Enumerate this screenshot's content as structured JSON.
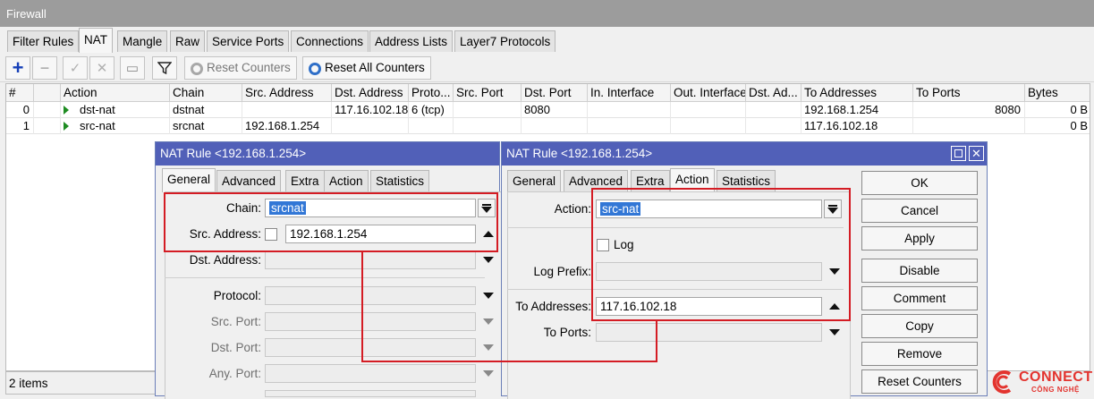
{
  "firewall": {
    "title": "Firewall",
    "tabs": [
      "Filter Rules",
      "NAT",
      "Mangle",
      "Raw",
      "Service Ports",
      "Connections",
      "Address Lists",
      "Layer7 Protocols"
    ],
    "active_tab": "NAT",
    "toolbar": {
      "reset_counters": "Reset Counters",
      "reset_all_counters": "Reset All Counters"
    },
    "columns": [
      "#",
      "Action",
      "Chain",
      "Src. Address",
      "Dst. Address",
      "Proto...",
      "Src. Port",
      "Dst. Port",
      "In. Interface",
      "Out. Interface",
      "Dst. Ad...",
      "To Addresses",
      "To Ports",
      "Bytes"
    ],
    "rows": [
      {
        "num": "0",
        "action": "dst-nat",
        "chain": "dstnat",
        "src_address": "",
        "dst_address": "117.16.102.18",
        "protocol": "6 (tcp)",
        "dst_port": "8080",
        "to_addresses": "192.168.1.254",
        "to_ports": "8080",
        "bytes": "0 B"
      },
      {
        "num": "1",
        "action": "src-nat",
        "chain": "srcnat",
        "src_address": "192.168.1.254",
        "dst_address": "",
        "protocol": "",
        "dst_port": "",
        "to_addresses": "117.16.102.18",
        "to_ports": "",
        "bytes": "0 B"
      }
    ],
    "status": "2 items"
  },
  "dialog_general": {
    "title": "NAT Rule <192.168.1.254>",
    "tabs": [
      "General",
      "Advanced",
      "Extra",
      "Action",
      "Statistics"
    ],
    "active_tab": "General",
    "fields": {
      "chain_label": "Chain:",
      "chain_value": "srcnat",
      "src_address_label": "Src. Address:",
      "src_address_value": "192.168.1.254",
      "dst_address_label": "Dst. Address:",
      "protocol_label": "Protocol:",
      "src_port_label": "Src. Port:",
      "dst_port_label": "Dst. Port:",
      "any_port_label": "Any. Port:"
    }
  },
  "dialog_action": {
    "title": "NAT Rule <192.168.1.254>",
    "tabs": [
      "General",
      "Advanced",
      "Extra",
      "Action",
      "Statistics"
    ],
    "active_tab": "Action",
    "fields": {
      "action_label": "Action:",
      "action_value": "src-nat",
      "log_label": "Log",
      "log_prefix_label": "Log Prefix:",
      "to_addresses_label": "To Addresses:",
      "to_addresses_value": "117.16.102.18",
      "to_ports_label": "To Ports:"
    },
    "buttons": [
      "OK",
      "Cancel",
      "Apply",
      "Disable",
      "Comment",
      "Copy",
      "Remove",
      "Reset Counters"
    ]
  },
  "logo": {
    "line1": "CONNECT",
    "line2": "CÔNG NGHỆ"
  },
  "colors": {
    "title_bar": "#5160b8",
    "highlight_box": "#d41c24",
    "selection": "#3277d6",
    "logo": "#e3342f"
  }
}
